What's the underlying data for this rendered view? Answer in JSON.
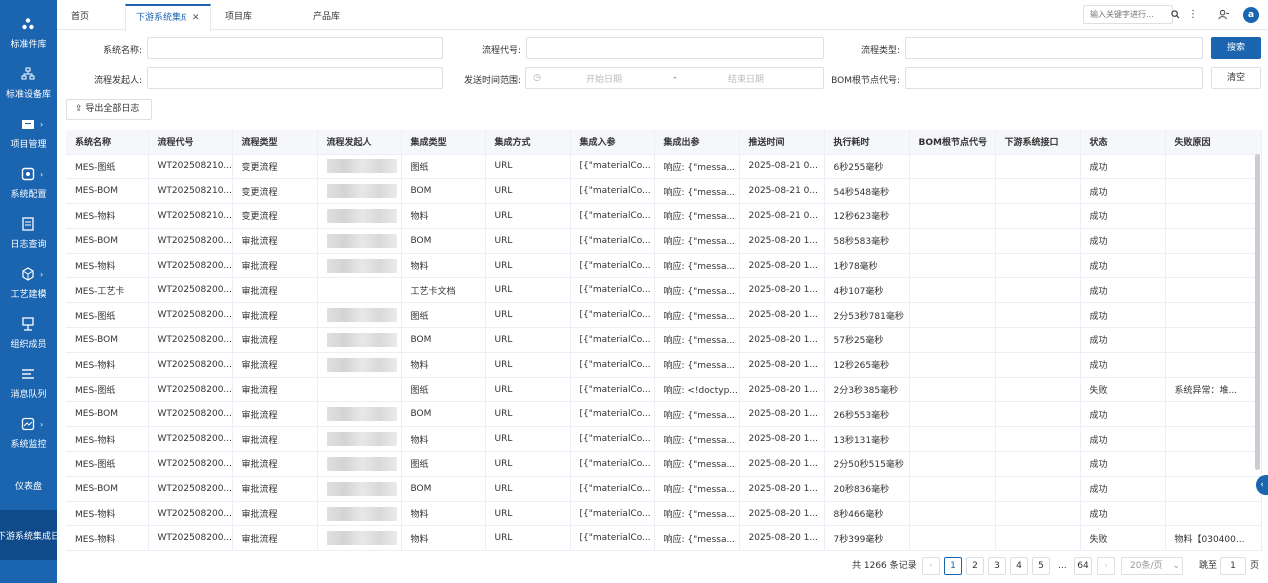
{
  "sidebar": {
    "items": [
      {
        "label": "标准件库",
        "icon": "cluster-icon",
        "chevron": false
      },
      {
        "label": "标准设备库",
        "icon": "org-chart-icon",
        "chevron": false
      },
      {
        "label": "项目管理",
        "icon": "folder-icon",
        "chevron": true
      },
      {
        "label": "系统配置",
        "icon": "gear-icon",
        "chevron": true
      },
      {
        "label": "日志查询",
        "icon": "log-icon",
        "chevron": false
      },
      {
        "label": "工艺建模",
        "icon": "cube-icon",
        "chevron": true
      },
      {
        "label": "组织成员",
        "icon": "members-icon",
        "chevron": false
      },
      {
        "label": "消息队列",
        "icon": "list-icon",
        "chevron": false
      },
      {
        "label": "系统监控",
        "icon": "monitor-icon",
        "chevron": true
      },
      {
        "label": "仪表盘",
        "icon": "",
        "chevron": false
      },
      {
        "label": "下游系统集成日",
        "icon": "",
        "chevron": false
      }
    ]
  },
  "tabs": [
    {
      "label": "首页",
      "active": false,
      "closable": false
    },
    {
      "label": "下游系统集成",
      "active": true,
      "closable": true
    },
    {
      "label": "项目库",
      "active": false,
      "closable": false
    },
    {
      "label": "产品库",
      "active": false,
      "closable": false
    }
  ],
  "topbar": {
    "search_placeholder": "输入关键字进行...",
    "avatar_letter": "a"
  },
  "filters": {
    "system_name_label": "系统名称:",
    "flow_code_label": "流程代号:",
    "flow_type_label": "流程类型:",
    "initiator_label": "流程发起人:",
    "send_time_label": "发送时间范围:",
    "start_date_placeholder": "开始日期",
    "date_sep": "-",
    "end_date_placeholder": "结束日期",
    "bom_code_label": "BOM根节点代号:",
    "search_button": "搜索",
    "clear_button": "清空",
    "export_button": "导出全部日志"
  },
  "table": {
    "columns": [
      "系统名称",
      "流程代号",
      "流程类型",
      "流程发起人",
      "集成类型",
      "集成方式",
      "集成入参",
      "集成出参",
      "推送时间",
      "执行耗时",
      "BOM根节点代号",
      "下游系统接口",
      "状态",
      "失败原因"
    ],
    "rows": [
      [
        "MES-图纸",
        "WT202508210...",
        "变更流程",
        "",
        "图纸",
        "URL",
        "[{\"materialCo...",
        "响应: {\"messa...",
        "2025-08-21 0...",
        "6秒255毫秒",
        "",
        "",
        "成功",
        ""
      ],
      [
        "MES-BOM",
        "WT202508210...",
        "变更流程",
        "",
        "BOM",
        "URL",
        "[{\"materialCo...",
        "响应: {\"messa...",
        "2025-08-21 0...",
        "54秒548毫秒",
        "",
        "",
        "成功",
        ""
      ],
      [
        "MES-物料",
        "WT202508210...",
        "变更流程",
        "",
        "物料",
        "URL",
        "[{\"materialCo...",
        "响应: {\"messa...",
        "2025-08-21 0...",
        "12秒623毫秒",
        "",
        "",
        "成功",
        ""
      ],
      [
        "MES-BOM",
        "WT202508200...",
        "审批流程",
        "",
        "BOM",
        "URL",
        "[{\"materialCo...",
        "响应: {\"messa...",
        "2025-08-20 1...",
        "58秒583毫秒",
        "",
        "",
        "成功",
        ""
      ],
      [
        "MES-物料",
        "WT202508200...",
        "审批流程",
        "",
        "物料",
        "URL",
        "[{\"materialCo...",
        "响应: {\"messa...",
        "2025-08-20 1...",
        "1秒78毫秒",
        "",
        "",
        "成功",
        ""
      ],
      [
        "MES-工艺卡",
        "WT202508200...",
        "审批流程",
        "",
        "工艺卡文档",
        "URL",
        "[{\"materialCo...",
        "响应: {\"messa...",
        "2025-08-20 1...",
        "4秒107毫秒",
        "",
        "",
        "成功",
        ""
      ],
      [
        "MES-图纸",
        "WT202508200...",
        "审批流程",
        "",
        "图纸",
        "URL",
        "[{\"materialCo...",
        "响应: {\"messa...",
        "2025-08-20 1...",
        "2分53秒781毫秒",
        "",
        "",
        "成功",
        ""
      ],
      [
        "MES-BOM",
        "WT202508200...",
        "审批流程",
        "",
        "BOM",
        "URL",
        "[{\"materialCo...",
        "响应: {\"messa...",
        "2025-08-20 1...",
        "57秒25毫秒",
        "",
        "",
        "成功",
        ""
      ],
      [
        "MES-物料",
        "WT202508200...",
        "审批流程",
        "",
        "物料",
        "URL",
        "[{\"materialCo...",
        "响应: {\"messa...",
        "2025-08-20 1...",
        "12秒265毫秒",
        "",
        "",
        "成功",
        ""
      ],
      [
        "MES-图纸",
        "WT202508200...",
        "审批流程",
        "",
        "图纸",
        "URL",
        "[{\"materialCo...",
        "响应: <!doctyp...",
        "2025-08-20 1...",
        "2分3秒385毫秒",
        "",
        "",
        "失败",
        "系统异常：堆..."
      ],
      [
        "MES-BOM",
        "WT202508200...",
        "审批流程",
        "",
        "BOM",
        "URL",
        "[{\"materialCo...",
        "响应: {\"messa...",
        "2025-08-20 1...",
        "26秒553毫秒",
        "",
        "",
        "成功",
        ""
      ],
      [
        "MES-物料",
        "WT202508200...",
        "审批流程",
        "",
        "物料",
        "URL",
        "[{\"materialCo...",
        "响应: {\"messa...",
        "2025-08-20 1...",
        "13秒131毫秒",
        "",
        "",
        "成功",
        ""
      ],
      [
        "MES-图纸",
        "WT202508200...",
        "审批流程",
        "",
        "图纸",
        "URL",
        "[{\"materialCo...",
        "响应: {\"messa...",
        "2025-08-20 1...",
        "2分50秒515毫秒",
        "",
        "",
        "成功",
        ""
      ],
      [
        "MES-BOM",
        "WT202508200...",
        "审批流程",
        "",
        "BOM",
        "URL",
        "[{\"materialCo...",
        "响应: {\"messa...",
        "2025-08-20 1...",
        "20秒836毫秒",
        "",
        "",
        "成功",
        ""
      ],
      [
        "MES-物料",
        "WT202508200...",
        "审批流程",
        "",
        "物料",
        "URL",
        "[{\"materialCo...",
        "响应: {\"messa...",
        "2025-08-20 1...",
        "8秒466毫秒",
        "",
        "",
        "成功",
        ""
      ],
      [
        "MES-物料",
        "WT202508200...",
        "审批流程",
        "",
        "物料",
        "URL",
        "[{\"materialCo...",
        "响应: {\"messa...",
        "2025-08-20 1...",
        "7秒399毫秒",
        "",
        "",
        "失败",
        "物料【030400..."
      ]
    ]
  },
  "pagination": {
    "total_text": "共 1266 条记录",
    "prev": "‹",
    "pages": [
      "1",
      "2",
      "3",
      "4",
      "5"
    ],
    "ellipsis": "...",
    "last_page": "64",
    "next": "›",
    "page_size": "20条/页",
    "jump_label": "跳至",
    "jump_value": "1",
    "page_suffix": "页"
  },
  "colors": {
    "primary": "#1a64b0",
    "sidebar_bg": "#1a64b0"
  }
}
